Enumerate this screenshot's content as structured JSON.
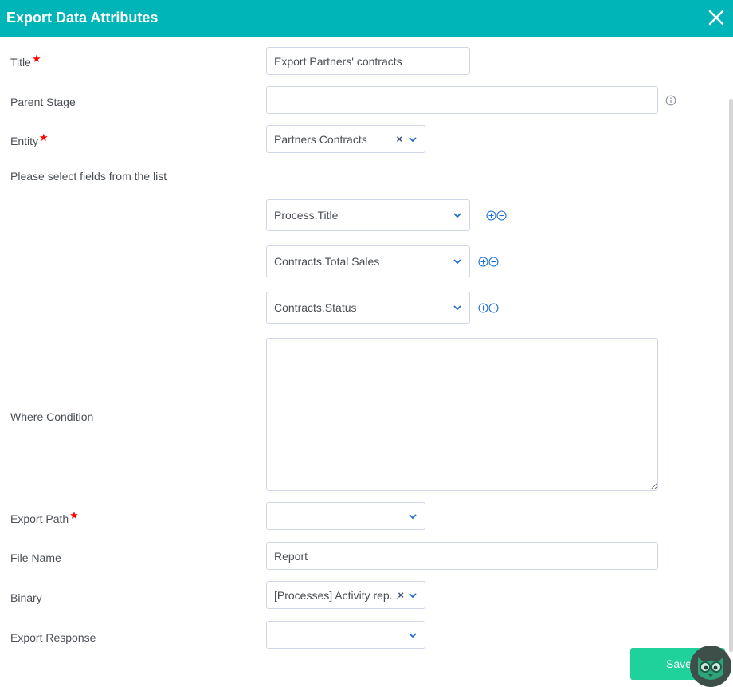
{
  "dialog": {
    "title": "Export Data Attributes",
    "close_icon": "close-icon"
  },
  "form": {
    "title": {
      "label": "Title",
      "required": "★",
      "value": "Export Partners' contracts"
    },
    "parent_stage": {
      "label": "Parent Stage",
      "value": "",
      "info_icon": "info-icon"
    },
    "entity": {
      "label": "Entity",
      "required": "★",
      "value": "Partners Contracts",
      "clear": "×"
    },
    "fields_prompt": "Please select fields from the list",
    "fields": [
      {
        "value": "Process.Title"
      },
      {
        "value": "Contracts.Total Sales"
      },
      {
        "value": "Contracts.Status"
      }
    ],
    "where_condition": {
      "label": "Where Condition",
      "value": ""
    },
    "export_path": {
      "label": "Export Path",
      "required": "★",
      "value": ""
    },
    "file_name": {
      "label": "File Name",
      "value": "Report"
    },
    "binary": {
      "label": "Binary",
      "value": "[Processes] Activity rep...",
      "clear": "×"
    },
    "export_response": {
      "label": "Export Response",
      "value": ""
    }
  },
  "footer": {
    "save_label": "Save"
  },
  "colors": {
    "header": "#00b5b8",
    "save": "#1fd19a",
    "required": "#ff0000",
    "icon_blue": "#1a6fd1"
  }
}
